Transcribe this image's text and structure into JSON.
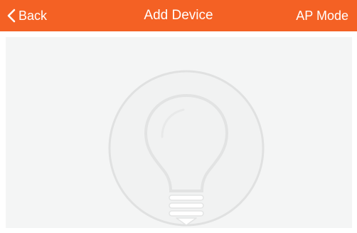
{
  "navbar": {
    "back_label": "Back",
    "title": "Add Device",
    "right_label": "AP Mode"
  },
  "colors": {
    "navbar_bg": "#f46124",
    "content_bg": "#f4f5f5",
    "circle_fill": "#f1f2f2",
    "circle_stroke": "#e0e1e1"
  },
  "icons": {
    "back": "chevron-left-icon",
    "illustration": "lightbulb-icon"
  }
}
